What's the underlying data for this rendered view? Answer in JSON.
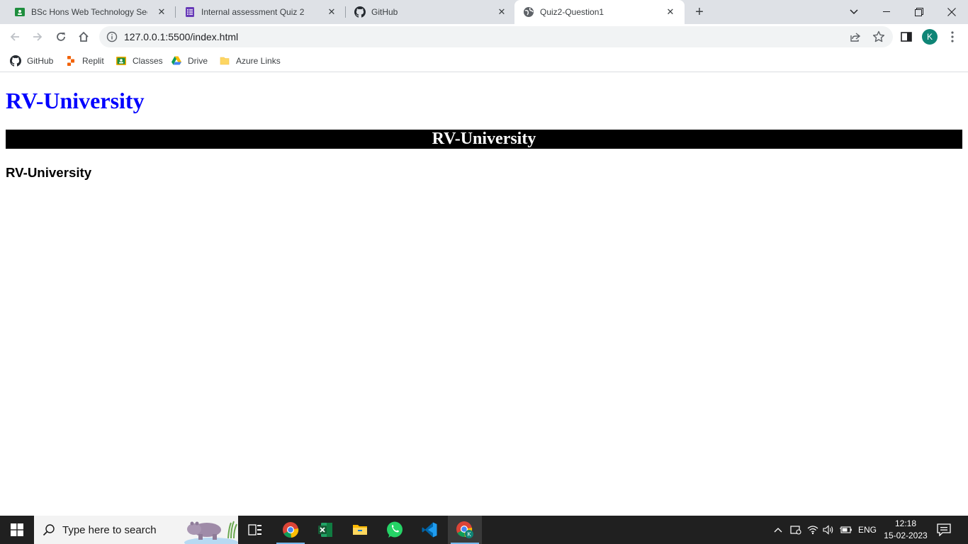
{
  "browser": {
    "tabs": [
      {
        "title": "BSc Hons Web Technology Sectio",
        "icon": "google-classroom-icon",
        "active": false
      },
      {
        "title": "Internal assessment Quiz 2",
        "icon": "google-forms-icon",
        "active": false
      },
      {
        "title": "GitHub",
        "icon": "github-icon",
        "active": false
      },
      {
        "title": "Quiz2-Question1",
        "icon": "globe-icon",
        "active": true
      }
    ],
    "url": "127.0.0.1:5500/index.html",
    "profile_initial": "K",
    "bookmarks": [
      {
        "label": "GitHub",
        "icon": "github-icon"
      },
      {
        "label": "Replit",
        "icon": "replit-icon"
      },
      {
        "label": "Classes",
        "icon": "google-classroom-icon"
      },
      {
        "label": "Drive",
        "icon": "google-drive-icon"
      },
      {
        "label": "Azure Links",
        "icon": "folder-icon"
      }
    ]
  },
  "page": {
    "heading1": "RV-University",
    "banner": "RV-University",
    "heading3": "RV-University"
  },
  "taskbar": {
    "search_placeholder": "Type here to search",
    "apps": [
      "task-view-icon",
      "chrome-icon",
      "excel-icon",
      "file-explorer-icon",
      "whatsapp-icon",
      "vscode-icon",
      "chrome-profile-icon"
    ],
    "language": "ENG",
    "time": "12:18",
    "date": "15-02-2023"
  },
  "colors": {
    "heading1": "#0000ff",
    "banner_bg": "#000000",
    "banner_text": "#ffffff",
    "avatar": "#0f8576",
    "tabstrip": "#dee1e6",
    "taskbar": "#202020"
  }
}
